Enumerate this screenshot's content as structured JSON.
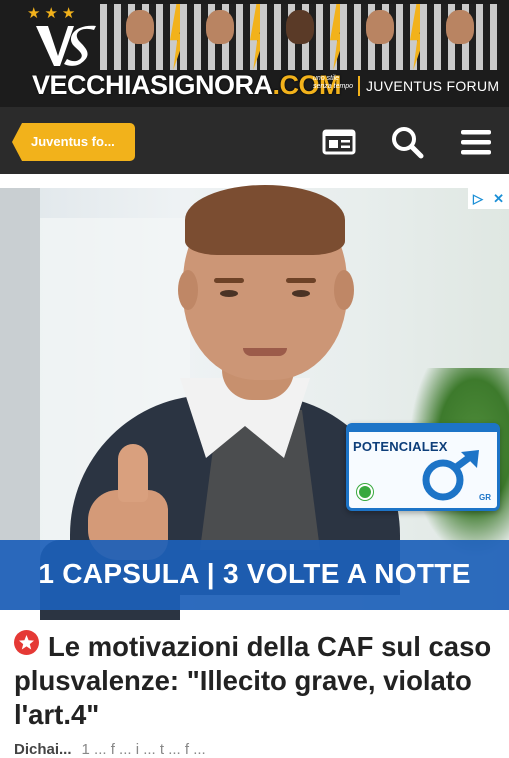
{
  "header": {
    "logo_text": "VECCHIASIGNORA",
    "logo_domain": ".COM",
    "tagline": "uno stile senza tempo",
    "forum_label": "JUVENTUS FORUM",
    "stars": [
      "★",
      "★",
      "★"
    ],
    "colors": {
      "accent": "#f2b21b",
      "background": "#1c1c1c"
    }
  },
  "nav": {
    "forum_button_label": "Juventus fo...",
    "icons": [
      "news-icon",
      "search-icon",
      "menu-icon"
    ]
  },
  "ad": {
    "product_name": "POTENCIALEX",
    "product_code": "GR",
    "slogan": "1 CAPSULA | 3 VOLTE A NOTTE",
    "ad_choices": [
      "▷",
      "✕"
    ],
    "colors": {
      "strip": "#1c5fb8"
    }
  },
  "article": {
    "title": "Le motivazioni della CAF sul caso plusvalenze: \"Illecito grave, violato l'art.4\"",
    "byline": "Dichai...",
    "byline_sub": "1 ... f ... i ... t ... f ..."
  }
}
